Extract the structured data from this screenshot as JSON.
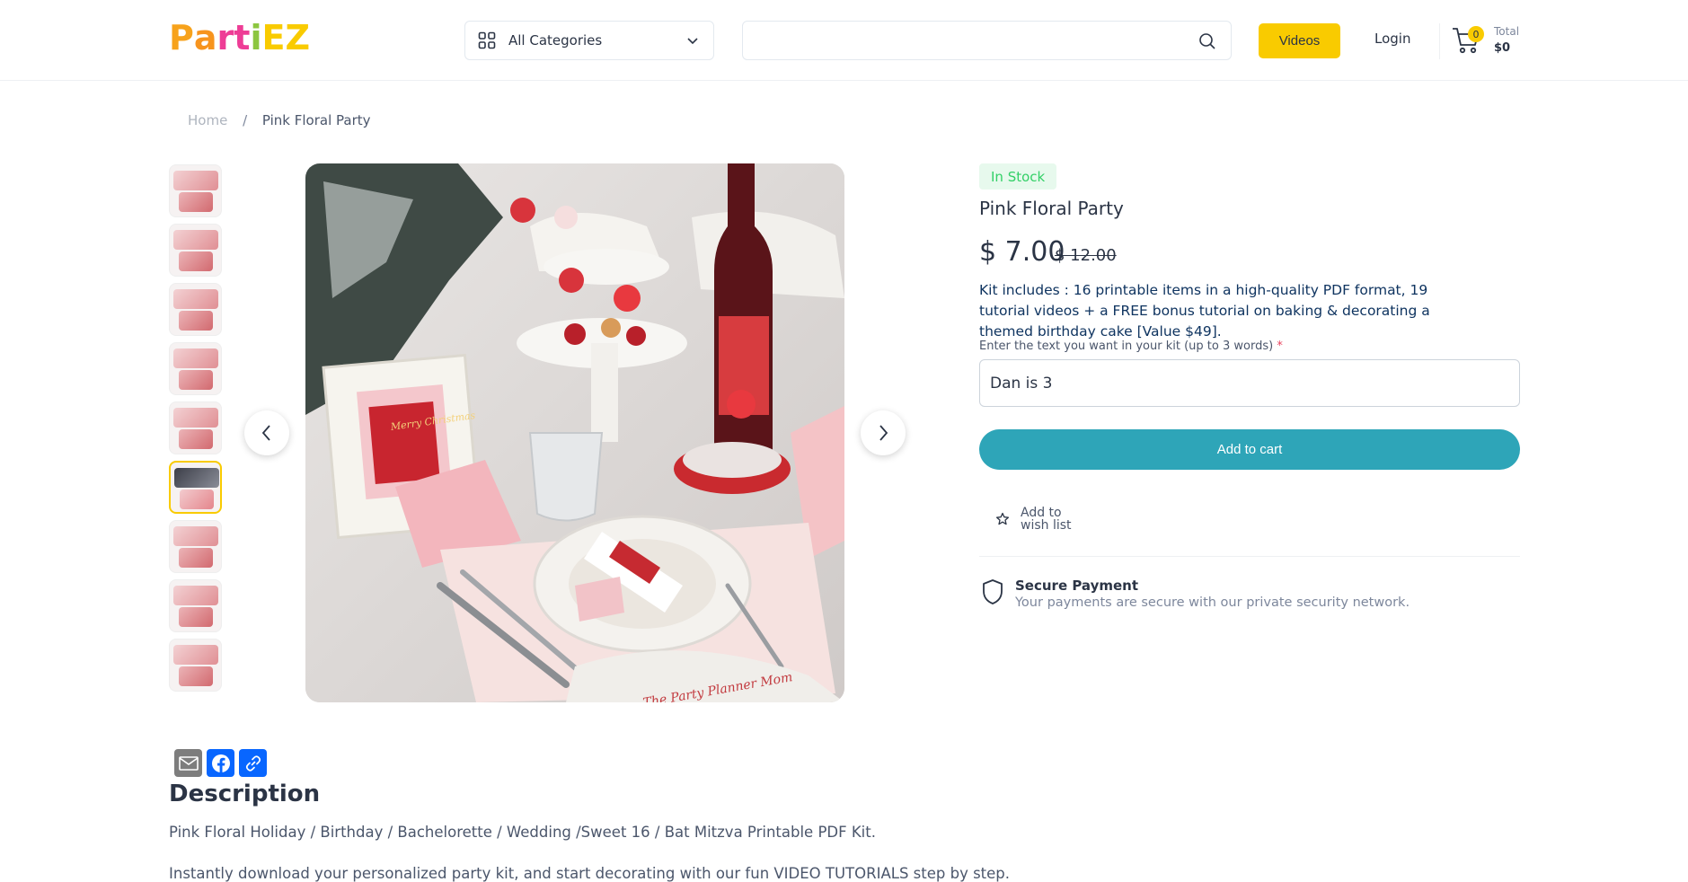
{
  "header": {
    "logo_text": "PartiEZ",
    "logo_letters": [
      "P",
      "a",
      "r",
      "t",
      "i",
      "E",
      "Z"
    ],
    "logo_colors": [
      "#f7a21b",
      "#f7941e",
      "#ee3d96",
      "#ee3d96",
      "#8cc63f",
      "#f9cb00",
      "#f9cb00"
    ],
    "categories_label": "All Categories",
    "search_placeholder": "",
    "videos_label": "Videos",
    "login_label": "Login",
    "cart_count": "0",
    "total_label": "Total",
    "total_value": "$0"
  },
  "breadcrumb": {
    "home": "Home",
    "separator": "/",
    "current": "Pink Floral Party"
  },
  "gallery": {
    "thumbnail_count": 9,
    "active_index": 5,
    "image_caption_text": "The Party Planner Mom",
    "frame_text": "Merry Christmas"
  },
  "product": {
    "stock_status": "In Stock",
    "title": "Pink Floral Party",
    "price": "$ 7.00",
    "old_price": "$ 12.00",
    "description": "Kit includes : 16 printable items in a high-quality PDF format, 19 tutorial videos + a FREE bonus tutorial on baking & decorating a themed birthday cake [Value $49].",
    "input_label": "Enter the text you want in your kit (up to 3 words)",
    "input_required_mark": "*",
    "input_value": "Dan is 3",
    "add_to_cart_label": "Add to cart",
    "wishlist_label_line1": "Add to",
    "wishlist_label_line2": "wish list",
    "secure_title": "Secure Payment",
    "secure_subtitle": "Your payments are secure with our private security network."
  },
  "description": {
    "heading": "Description",
    "line1": "Pink Floral Holiday / Birthday / Bachelorette / Wedding /Sweet 16 / Bat Mitzva Printable PDF Kit.",
    "line2": "Instantly download your personalized party kit, and start decorating with our fun VIDEO TUTORIALS step by step."
  },
  "colors": {
    "accent_yellow": "#f9cb00",
    "cart_button": "#2ea5b8",
    "stock_bg": "#e7f9ed",
    "stock_text": "#33d067"
  }
}
